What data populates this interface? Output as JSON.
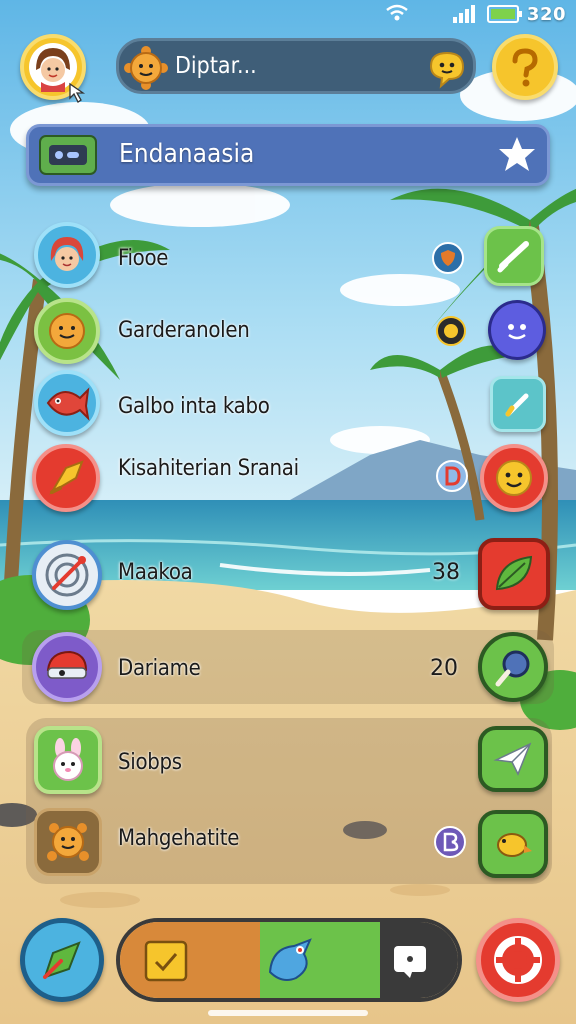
{
  "status_bar": {
    "time": "320",
    "icons": [
      "wifi-icon",
      "signal-icon",
      "battery-icon"
    ]
  },
  "search": {
    "value": "Diptar...",
    "icon": "sun-creature-icon",
    "chat_icon": "chat-bubble-icon"
  },
  "banner": {
    "title": "Endanaasia",
    "icon": "console-icon",
    "action_icon": "star-icon"
  },
  "list": [
    {
      "label": "Fiooe",
      "icon": "girl-avatar-icon",
      "badge_icon": "shield-icon",
      "action_icon": "check-icon"
    },
    {
      "label": "Garderanolen",
      "icon": "sun-face-icon",
      "badge_icon": "coin-icon",
      "action_icon": "chat-face-icon"
    },
    {
      "label": "Galbo inta kabo",
      "icon": "fish-icon",
      "badge_icon": "",
      "action_icon": "pencil-icon"
    },
    {
      "label": "Kisahiterian Sranai",
      "icon": "trumpet-icon",
      "badge_icon": "d-icon",
      "action_icon": "smiley-icon"
    },
    {
      "label": "Maakoa",
      "icon": "target-icon",
      "count": "38",
      "action_icon": "leaf-card-icon"
    },
    {
      "label": "Dariame",
      "icon": "helmet-icon",
      "count": "20",
      "action_icon": "magnifier-icon"
    },
    {
      "label": "Siobps",
      "icon": "bunny-icon",
      "action_icon": "paper-plane-icon"
    },
    {
      "label": "Mahgehatite",
      "icon": "critter-icon",
      "badge_icon": "b-icon",
      "action_icon": "bird-icon"
    }
  ],
  "bottom_nav": {
    "left_icon": "arrow-icon",
    "center_icons": [
      "note-icon",
      "creature-icon",
      "message-icon"
    ],
    "right_icon": "lifebuoy-icon"
  },
  "colors": {
    "banner": "#4f72b8",
    "search_bar": "#3f5e78",
    "accent_green": "#6cc24a",
    "accent_red": "#e43b2f",
    "accent_yellow": "#f6c52c"
  }
}
